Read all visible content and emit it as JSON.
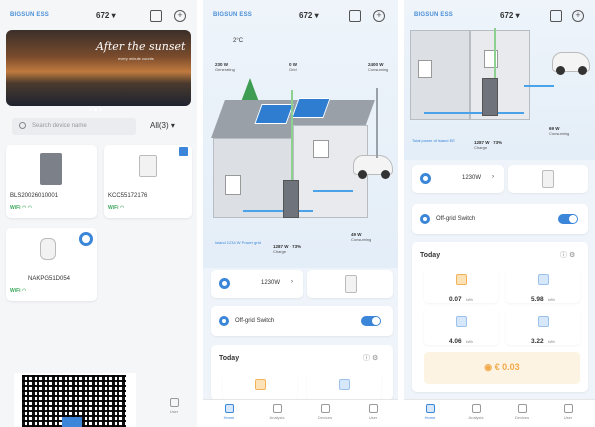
{
  "colors": {
    "accent": "#3b86d8",
    "wifi": "#3aa65a",
    "solar": "#2f7dd1",
    "money": "#f2a94a"
  },
  "common": {
    "logo": "BIGSUN ESS",
    "site": "672",
    "tabs": [
      "Home",
      "Analysis",
      "Devices",
      "User"
    ]
  },
  "screen1": {
    "banner_script": "After the sunset",
    "banner_sub": "every minute counts",
    "search_placeholder": "Search device name",
    "filter": "All(3)",
    "devices": [
      {
        "sn": "BLS20026010001",
        "status": "WiFi"
      },
      {
        "sn": "KCC55172176",
        "status": "WiFi"
      },
      {
        "sn": "NAKPG51D054",
        "status": "WiFi"
      }
    ]
  },
  "screen2": {
    "temp": "2°C",
    "flows": {
      "solar": {
        "value": "230 W",
        "label": "Generating"
      },
      "grid": {
        "value": "0 W",
        "label": "Grid"
      },
      "home": {
        "value": "2400 W",
        "label": "Consuming"
      },
      "battery": {
        "value": "1287 W",
        "pct": "73%",
        "label": "Charge"
      },
      "ev": {
        "value": "49 W",
        "label": "Consuming"
      },
      "today_note": "Island 1234 W Power grid"
    },
    "mode_value": "1230W",
    "offgrid_label": "Off-grid Switch",
    "today_label": "Today"
  },
  "screen3": {
    "flows": {
      "battery": {
        "value": "1287 W",
        "pct": "73%",
        "label": "Charge"
      },
      "ev": {
        "value": "69 W",
        "label": "Consuming"
      },
      "note": "Total power of island EE"
    },
    "mode_value": "1230W",
    "offgrid_label": "Off-grid Switch",
    "today_label": "Today",
    "stats": [
      {
        "value": "0.07",
        "unit": "kWh",
        "icon": "solar-icon"
      },
      {
        "value": "5.98",
        "unit": "kWh",
        "icon": "grid-import-icon"
      },
      {
        "value": "4.06",
        "unit": "kWh",
        "icon": "battery-icon"
      },
      {
        "value": "3.22",
        "unit": "kWh",
        "icon": "home-icon"
      }
    ],
    "savings": "€ 0.03"
  }
}
